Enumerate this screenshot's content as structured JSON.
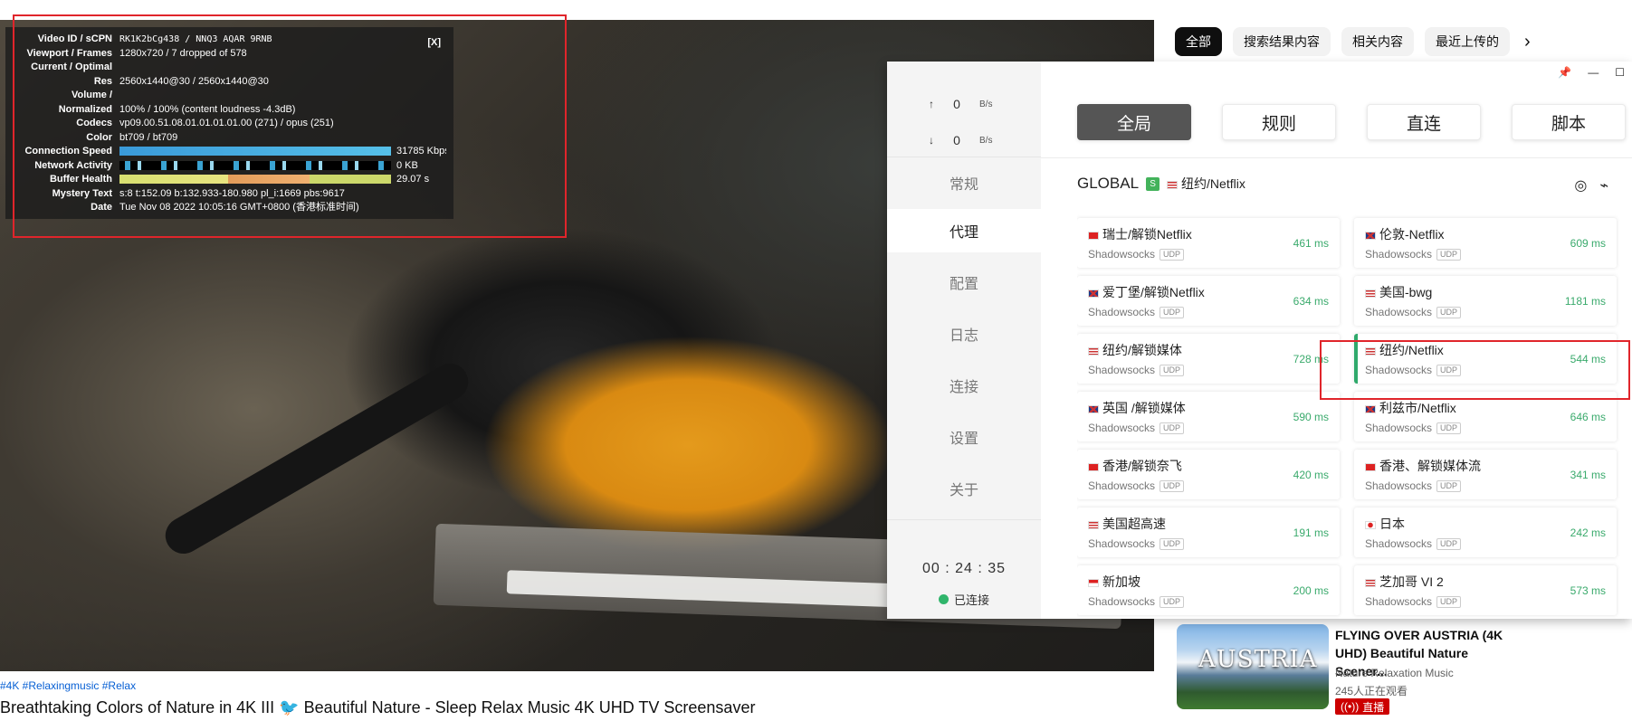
{
  "stats": {
    "close": "[X]",
    "rows": [
      {
        "k": "Video ID / sCPN",
        "v": "RK1K2bCg438  /  NNQ3 AQAR 9RNB"
      },
      {
        "k": "Viewport / Frames",
        "v": "1280x720 / 7 dropped of 578"
      },
      {
        "k": "Current / Optimal",
        "v": ""
      },
      {
        "k": "Res",
        "v": "2560x1440@30 / 2560x1440@30"
      },
      {
        "k": "Volume /",
        "v": ""
      },
      {
        "k": "Normalized",
        "v": "100% / 100% (content loudness -4.3dB)"
      },
      {
        "k": "Codecs",
        "v": "vp09.00.51.08.01.01.01.01.00 (271) / opus (251)"
      },
      {
        "k": "Color",
        "v": "bt709 / bt709"
      },
      {
        "k": "Connection Speed",
        "v": "31785 Kbps"
      },
      {
        "k": "Network Activity",
        "v": "0 KB"
      },
      {
        "k": "Buffer Health",
        "v": "29.07 s"
      },
      {
        "k": "Mystery Text",
        "v": "s:8 t:152.09 b:132.933-180.980 pl_i:1669 pbs:9617"
      },
      {
        "k": "Date",
        "v": "Tue Nov 08 2022 10:05:16 GMT+0800 (香港标准时间)"
      }
    ]
  },
  "video": {
    "tags": "#4K #Relaxingmusic #Relax",
    "title": "Breathtaking Colors of Nature in 4K III 🐦 Beautiful Nature - Sleep Relax Music 4K UHD TV Screensaver"
  },
  "chips": [
    "全部",
    "搜索结果内容",
    "相关内容",
    "最近上传的"
  ],
  "chip_next": "›",
  "recommend": {
    "thumb_text": "AUSTRIA",
    "title": "FLYING OVER AUSTRIA (4K UHD) Beautiful Nature Scener...",
    "channel": "Nature Relaxation Music",
    "views": "245人正在观看",
    "live": "直播"
  },
  "clash": {
    "window_controls": {
      "pin": "📌",
      "minimize": "—",
      "maximize": "☐"
    },
    "traffic": {
      "up_arrow": "↑",
      "up_value": "0",
      "up_unit": "B/s",
      "down_arrow": "↓",
      "down_value": "0",
      "down_unit": "B/s"
    },
    "nav": [
      "常规",
      "代理",
      "配置",
      "日志",
      "连接",
      "设置",
      "关于"
    ],
    "timer": "00 : 24 : 35",
    "status": "已连接",
    "modes": [
      "全局",
      "规则",
      "直连",
      "脚本"
    ],
    "group": {
      "name": "GLOBAL",
      "badge": "S",
      "selected": "纽约/Netflix"
    },
    "icons": {
      "locate": "◎",
      "speed": "⌁"
    },
    "proxies": [
      {
        "name": "瑞士/解锁Netflix",
        "flag": "ch",
        "type": "Shadowsocks",
        "udp": "UDP",
        "delay": "461 ms"
      },
      {
        "name": "伦敦-Netflix",
        "flag": "gb",
        "type": "Shadowsocks",
        "udp": "UDP",
        "delay": "609 ms"
      },
      {
        "name": "爱丁堡/解锁Netflix",
        "flag": "gb",
        "type": "Shadowsocks",
        "udp": "UDP",
        "delay": "634 ms"
      },
      {
        "name": "美国-bwg",
        "flag": "us",
        "type": "Shadowsocks",
        "udp": "UDP",
        "delay": "1181 ms"
      },
      {
        "name": "纽约/解锁媒体",
        "flag": "us",
        "type": "Shadowsocks",
        "udp": "UDP",
        "delay": "728 ms"
      },
      {
        "name": "纽约/Netflix",
        "flag": "us",
        "type": "Shadowsocks",
        "udp": "UDP",
        "delay": "544 ms",
        "active": true
      },
      {
        "name": "英国 /解锁媒体",
        "flag": "gb",
        "type": "Shadowsocks",
        "udp": "UDP",
        "delay": "590 ms"
      },
      {
        "name": "利兹市/Netflix",
        "flag": "gb",
        "type": "Shadowsocks",
        "udp": "UDP",
        "delay": "646 ms"
      },
      {
        "name": "香港/解锁奈飞",
        "flag": "hk",
        "type": "Shadowsocks",
        "udp": "UDP",
        "delay": "420 ms"
      },
      {
        "name": "香港、解锁媒体流",
        "flag": "hk",
        "type": "Shadowsocks",
        "udp": "UDP",
        "delay": "341 ms"
      },
      {
        "name": "美国超高速",
        "flag": "us",
        "type": "Shadowsocks",
        "udp": "UDP",
        "delay": "191 ms"
      },
      {
        "name": "日本",
        "flag": "jp",
        "type": "Shadowsocks",
        "udp": "UDP",
        "delay": "242 ms"
      },
      {
        "name": "新加坡",
        "flag": "sg",
        "type": "Shadowsocks",
        "udp": "UDP",
        "delay": "200 ms"
      },
      {
        "name": "芝加哥 VI 2",
        "flag": "us",
        "type": "Shadowsocks",
        "udp": "UDP",
        "delay": "573 ms"
      }
    ]
  },
  "colors": {
    "accent_green": "#30b56b",
    "annotation_red": "#e0252b",
    "youtube_red": "#cc0000"
  }
}
